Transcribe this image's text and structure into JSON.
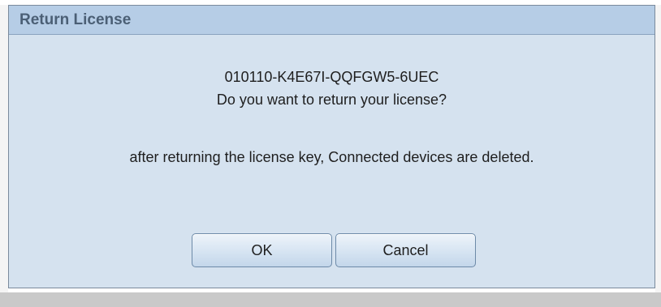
{
  "dialog": {
    "title": "Return License",
    "license_key": "010110-K4E67I-QQFGW5-6UEC",
    "question": "Do you want to return your license?",
    "warning": "after returning the license key, Connected devices are deleted.",
    "ok_label": "OK",
    "cancel_label": "Cancel"
  },
  "colors": {
    "titlebar": "#b6cde6",
    "body": "#d5e2ef",
    "title_text": "#4b5f75"
  }
}
